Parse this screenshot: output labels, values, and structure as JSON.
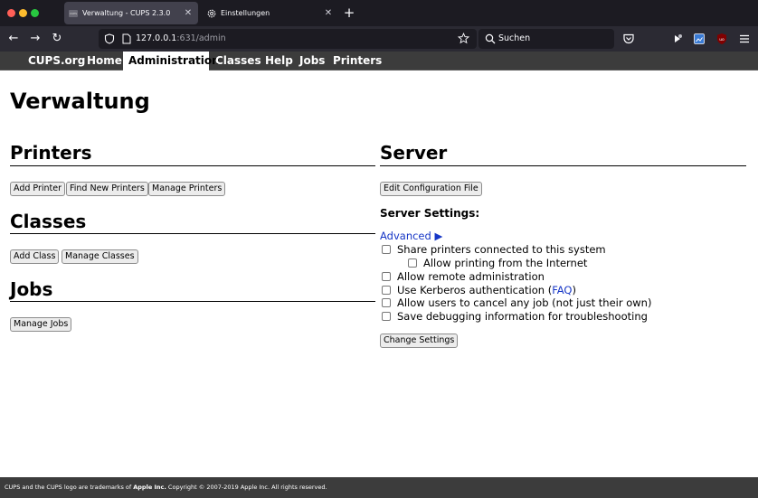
{
  "browser": {
    "tabs": [
      {
        "title": "Verwaltung - CUPS 2.3.0",
        "favicon_text": "CUPS"
      },
      {
        "title": "Einstellungen"
      }
    ],
    "url_host": "127.0.0.1",
    "url_path": ":631/admin",
    "search_placeholder": "Suchen"
  },
  "cups_nav": [
    "CUPS.org",
    "Home",
    "Administration",
    "Classes",
    "Help",
    "Jobs",
    "Printers"
  ],
  "page_title": "Verwaltung",
  "printers": {
    "heading": "Printers",
    "buttons": [
      "Add Printer",
      "Find New Printers",
      "Manage Printers"
    ]
  },
  "classes": {
    "heading": "Classes",
    "buttons": [
      "Add Class",
      "Manage Classes"
    ]
  },
  "jobs": {
    "heading": "Jobs",
    "buttons": [
      "Manage Jobs"
    ]
  },
  "server": {
    "heading": "Server",
    "edit_button": "Edit Configuration File",
    "settings_heading": "Server Settings:",
    "advanced_link": "Advanced ▶",
    "options": {
      "share": "Share printers connected to this system",
      "internet": "Allow printing from the Internet",
      "remote": "Allow remote administration",
      "kerberos_pre": "Use Kerberos authentication (",
      "kerberos_link": "FAQ",
      "kerberos_post": ")",
      "cancel": "Allow users to cancel any job (not just their own)",
      "debug": "Save debugging information for troubleshooting"
    },
    "change_button": "Change Settings"
  },
  "footer": {
    "pre": "CUPS and the CUPS logo are trademarks of ",
    "company": "Apple Inc.",
    "post": " Copyright © 2007-2019 Apple Inc. All rights reserved."
  }
}
